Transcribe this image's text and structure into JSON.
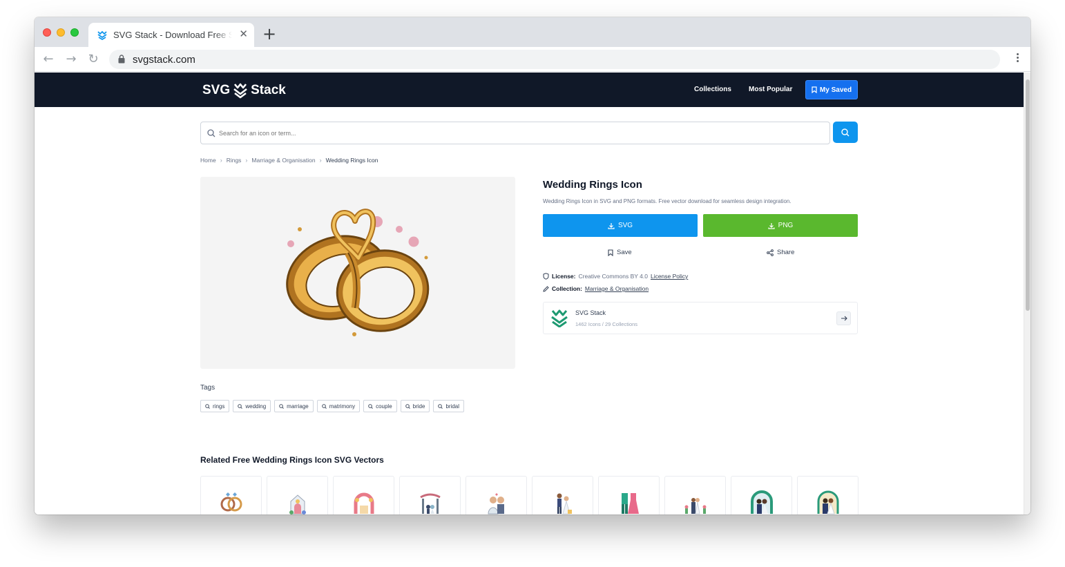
{
  "browser": {
    "tab_title": "SVG Stack - Download Free SVG Icons",
    "url": "svgstack.com",
    "new_tab": "+",
    "close_tab": "✕"
  },
  "site": {
    "logo_left": "SVG",
    "logo_right": "Stack",
    "nav": {
      "collections": "Collections",
      "most_popular": "Most Popular",
      "my_saved": "My Saved"
    },
    "search": {
      "placeholder": "Search for an icon or term..."
    }
  },
  "breadcrumb": [
    "Home",
    "Rings",
    "Marriage & Organisation",
    "Wedding Rings Icon"
  ],
  "icon": {
    "title": "Wedding Rings Icon",
    "description": "Wedding Rings Icon in SVG and PNG formats. Free vector download for seamless design integration.",
    "download_svg": "SVG",
    "download_png": "PNG",
    "save": "Save",
    "share": "Share",
    "license_label": "License:",
    "license_value": "Creative Commons BY 4.0",
    "license_link": "License Policy",
    "collection_label": "Collection:",
    "collection_value": "Marriage & Organisation"
  },
  "collection_card": {
    "name": "SVG Stack",
    "stats": "1462 Icons / 29 Collections"
  },
  "tags_section": {
    "label": "Tags",
    "tags": [
      "rings",
      "wedding",
      "marriage",
      "matrimony",
      "couple",
      "bride",
      "bridal"
    ]
  },
  "related": {
    "title": "Related Free Wedding Rings Icon SVG Vectors",
    "items": [
      "rings-icon",
      "chapel-icon",
      "arch-icon",
      "altar-icon",
      "couple-icon",
      "groom-bride-icon",
      "outfits-icon",
      "ceremony-icon",
      "couple-arch-icon",
      "couple-portrait-icon"
    ]
  },
  "colors": {
    "header_bg": "#101828",
    "primary_blue": "#0e95ee",
    "saved_blue": "#1570ef",
    "png_green": "#5ab82e",
    "gold": "#e0a431"
  }
}
